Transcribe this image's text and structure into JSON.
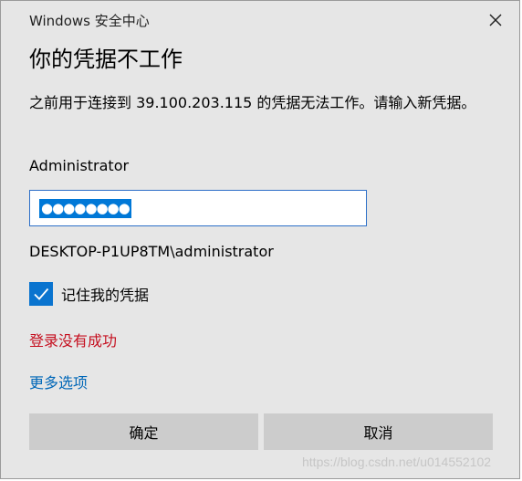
{
  "window": {
    "title": "Windows 安全中心"
  },
  "dialog": {
    "heading": "你的凭据不工作",
    "message": "之前用于连接到 39.100.203.115 的凭据无法工作。请输入新凭据。",
    "username": "Administrator",
    "password_masked": "●●●●●●●●",
    "domain_user": "DESKTOP-P1UP8TM\\administrator",
    "remember_label": "记住我的凭据",
    "remember_checked": true,
    "error_text": "登录没有成功",
    "more_options": "更多选项",
    "ok_label": "确定",
    "cancel_label": "取消"
  },
  "watermark": "https://blog.csdn.net/u014552102",
  "colors": {
    "accent": "#0078d7",
    "error": "#c50f1f",
    "link": "#0067b8",
    "button_bg": "#cccccc",
    "dialog_bg": "#e6e6e6"
  }
}
